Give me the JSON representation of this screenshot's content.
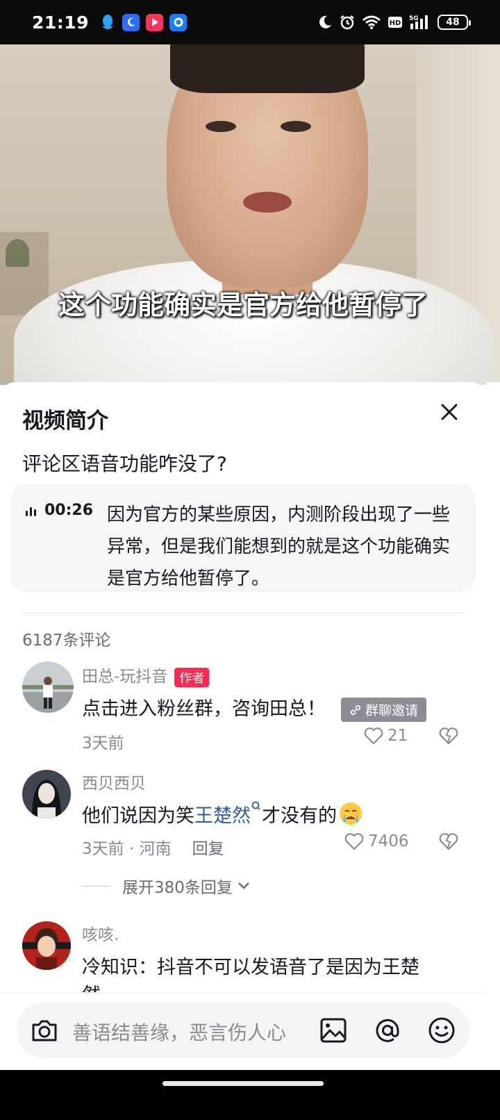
{
  "status_bar": {
    "time": "21:19",
    "notification_icons": [
      "qq-icon",
      "moon-app-icon",
      "video-app-icon",
      "browser-app-icon"
    ],
    "system_icons": [
      "do-not-disturb-icon",
      "alarm-icon",
      "wifi-icon",
      "hd-icon",
      "5g-signal-icon"
    ],
    "battery": "48"
  },
  "video": {
    "subtitle": "这个功能确实是官方给他暂停了"
  },
  "sheet": {
    "title": "视频简介",
    "headline": "评论区语音功能咋没了?",
    "summary": {
      "timestamp": "00:26",
      "text": "因为官方的某些原因，内测阶段出现了一些异常，但是我们能想到的就是这个功能确实是官方给他暂停了。"
    },
    "comment_count": "6187条评论",
    "comments": [
      {
        "name": "田总-玩抖音",
        "badge": "作者",
        "text": "点击进入粉丝群，咨询田总！",
        "invite_label": "群聊邀请",
        "meta": "3天前",
        "likes": "21"
      },
      {
        "name": "西贝西贝",
        "text_before": "他们说因为笑",
        "text_link": "王楚然",
        "text_after": "才没有的",
        "meta": "3天前 · 河南",
        "reply": "回复",
        "likes": "7406",
        "expand": "展开380条回复"
      },
      {
        "name": "咳咳.",
        "text_line1": "冷知识：抖音不可以发语音了是因为王楚",
        "text_line2": "然"
      }
    ]
  },
  "input": {
    "placeholder": "善语结善缘，恶言伤人心"
  },
  "colors": {
    "badge": "#fe2c55",
    "link": "#2f5ca8",
    "muted": "#8a8a93"
  }
}
